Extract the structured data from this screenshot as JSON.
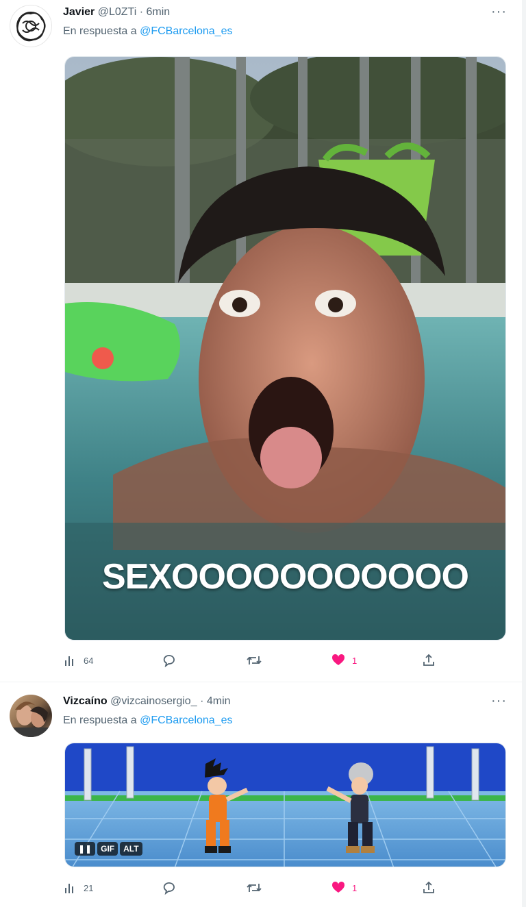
{
  "tweets": [
    {
      "name": "Javier",
      "handle": "@L0ZTi",
      "separator": "·",
      "time": "6min",
      "reply_prefix": "En respuesta a ",
      "reply_to": "@FCBarcelona_es",
      "media_caption": "SEXOOOOOOOOOOO",
      "stats": {
        "views": "64",
        "likes": "1"
      },
      "icons": [
        "views-icon",
        "reply-icon",
        "retweet-icon",
        "like-icon",
        "share-icon",
        "more-icon"
      ]
    },
    {
      "name": "Vizcaíno",
      "handle": "@vizcainosergio_",
      "separator": "·",
      "time": "4min",
      "reply_prefix": "En respuesta a ",
      "reply_to": "@FCBarcelona_es",
      "media_badges": {
        "pause": "❚❚",
        "gif": "GIF",
        "alt": "ALT"
      },
      "stats": {
        "views": "21",
        "likes": "1"
      },
      "icons": [
        "views-icon",
        "reply-icon",
        "retweet-icon",
        "like-icon",
        "share-icon",
        "more-icon"
      ]
    }
  ],
  "colors": {
    "accent": "#1d9bf0",
    "like": "#f91880",
    "secondary_text": "#536471"
  }
}
